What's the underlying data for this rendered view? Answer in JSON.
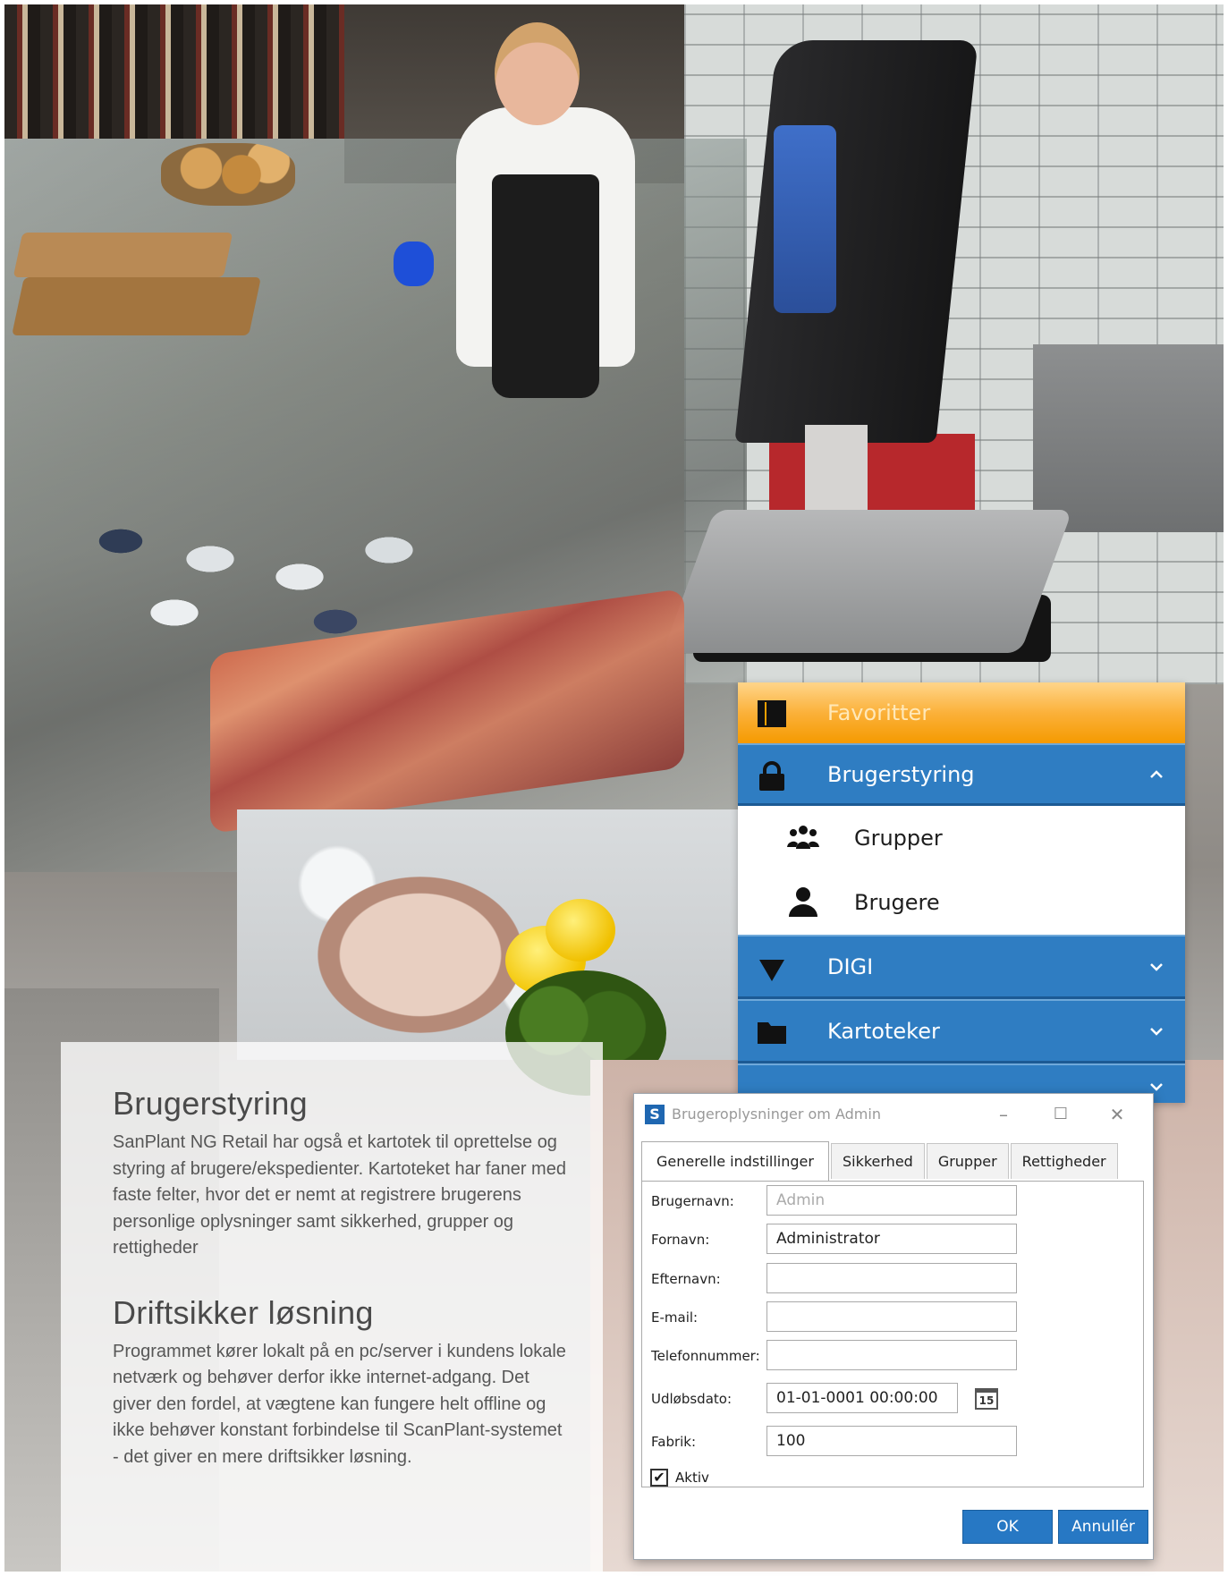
{
  "text": {
    "heading1": "Brugerstyring",
    "para1": "SanPlant NG Retail har også et kartotek til oprettelse og styring af brugere/ekspedienter. Kartoteket har faner med faste felter, hvor det er nemt at registrere brugerens personlige oplysninger samt sikkerhed, grupper og rettigheder",
    "heading2": "Driftsikker løsning",
    "para2": "Programmet kører lokalt på en pc/server i kundens lokale netværk og behøver derfor ikke internet-adgang. Det giver den fordel, at vægtene kan fungere helt offline og ikke behøver konstant forbindelse til ScanPlant-systemet - det giver en mere driftsikker løsning."
  },
  "menu": {
    "favorites": "Favoritter",
    "user_mgmt": "Brugerstyring",
    "groups": "Grupper",
    "users": "Brugere",
    "digi": "DIGI",
    "files": "Kartoteker"
  },
  "dialog": {
    "logo": "S",
    "title": "Brugeroplysninger om Admin",
    "tabs": [
      "Generelle indstillinger",
      "Sikkerhed",
      "Grupper",
      "Rettigheder"
    ],
    "fields": [
      {
        "label": "Brugernavn:",
        "value": "Admin"
      },
      {
        "label": "Fornavn:",
        "value": "Administrator"
      },
      {
        "label": "Efternavn:",
        "value": ""
      },
      {
        "label": "E-mail:",
        "value": ""
      },
      {
        "label": "Telefonnummer:",
        "value": ""
      },
      {
        "label": "Udløbsdato:",
        "value": "01-01-0001 00:00:00"
      },
      {
        "label": "Fabrik:",
        "value": "100"
      }
    ],
    "calendar_day": "15",
    "active_label": "Aktiv",
    "active_checked": "✔",
    "ok": "OK",
    "cancel": "Annullér"
  },
  "colors": {
    "menu_blue": "#2f7dc2",
    "menu_orange": "#f59a00",
    "button_blue": "#2778c4"
  }
}
